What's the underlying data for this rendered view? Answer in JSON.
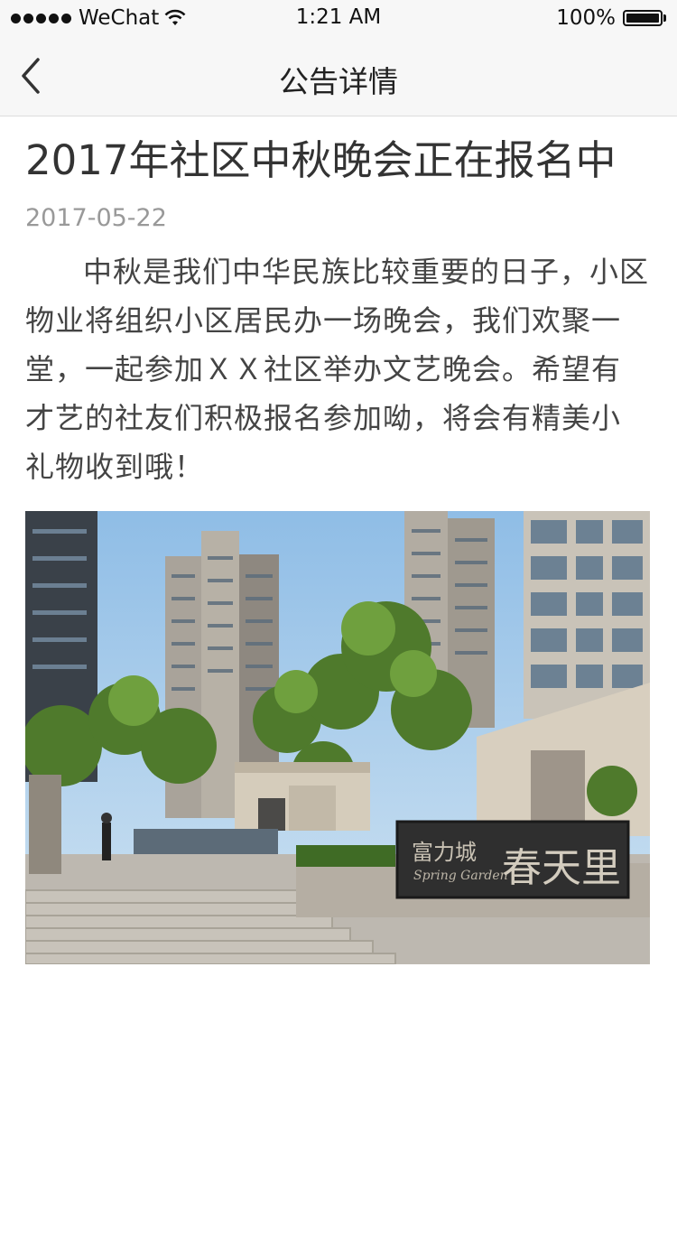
{
  "status_bar": {
    "carrier": "WeChat",
    "time": "1:21 AM",
    "battery_percent": "100%",
    "battery_level": 1.0,
    "signal_bars": 5
  },
  "nav": {
    "title": "公告详情",
    "back_icon": "chevron-left-icon"
  },
  "article": {
    "title": "2017年社区中秋晚会正在报名中",
    "date": "2017-05-22",
    "body": "中秋是我们中华民族比较重要的日子，小区物业将组织小区居民办一场晚会，我们欢聚一堂，一起参加ＸＸ社区举办文艺晚会。希望有才艺的社友们积极报名参加呦，将会有精美小礼物收到哦！",
    "image": {
      "sign_text_1": "富力城",
      "sign_text_2": "春天里",
      "sign_text_en": "Spring Garden"
    }
  },
  "colors": {
    "bar_background": "#f7f7f7",
    "date_gray": "#999999",
    "text": "#333333"
  }
}
